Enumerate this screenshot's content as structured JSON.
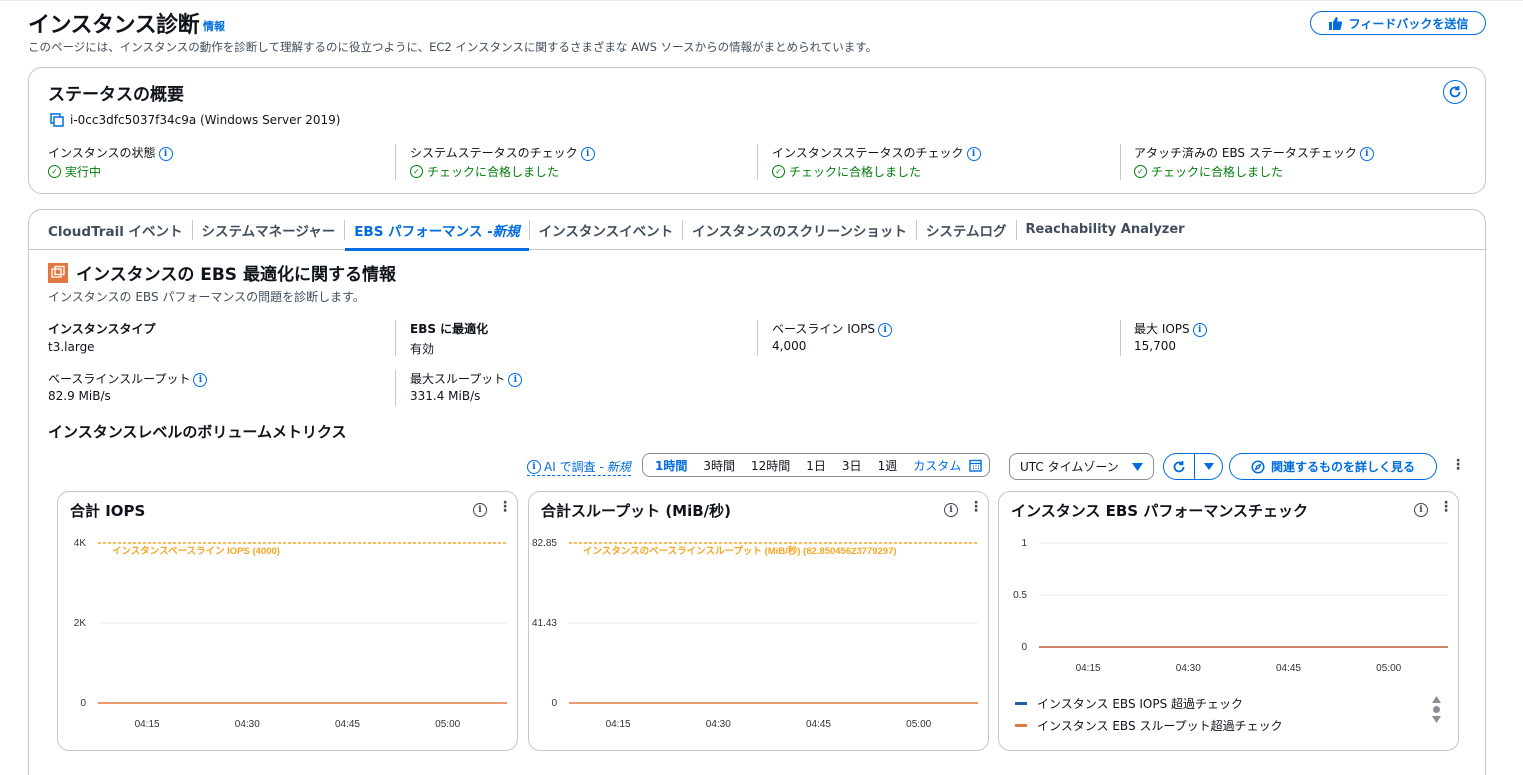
{
  "header": {
    "title": "インスタンス診断",
    "info_link": "情報",
    "description": "このページには、インスタンスの動作を診断して理解するのに役立つように、EC2 インスタンスに関するさまざまな AWS ソースからの情報がまとめられています。",
    "feedback_button": "フィードバックを送信"
  },
  "status": {
    "title": "ステータスの概要",
    "instance_id": "i-0cc3dfc5037f34c9a (Windows Server 2019)",
    "items": [
      {
        "label": "インスタンスの状態",
        "value": "実行中"
      },
      {
        "label": "システムステータスのチェック",
        "value": "チェックに合格しました"
      },
      {
        "label": "インスタンスステータスのチェック",
        "value": "チェックに合格しました"
      },
      {
        "label": "アタッチ済みの EBS ステータスチェック",
        "value": "チェックに合格しました"
      }
    ]
  },
  "tabs": [
    {
      "label": "CloudTrail イベント"
    },
    {
      "label": "システムマネージャー"
    },
    {
      "label": "EBS パフォーマンス - ",
      "suffix": "新規",
      "active": true
    },
    {
      "label": "インスタンスイベント"
    },
    {
      "label": "インスタンスのスクリーンショット"
    },
    {
      "label": "システムログ"
    },
    {
      "label": "Reachability Analyzer"
    }
  ],
  "ebs": {
    "title": "インスタンスの EBS 最適化に関する情報",
    "subtitle": "インスタンスの EBS パフォーマンスの問題を診断します。",
    "fields": {
      "instance_type": {
        "label": "インスタンスタイプ",
        "value": "t3.large"
      },
      "ebs_optimized": {
        "label": "EBS に最適化",
        "value": "有効"
      },
      "baseline_iops": {
        "label": "ベースライン IOPS",
        "value": "4,000"
      },
      "max_iops": {
        "label": "最大 IOPS",
        "value": "15,700"
      },
      "baseline_throughput": {
        "label": "ベースラインスループット",
        "value": "82.9 MiB/s"
      },
      "max_throughput": {
        "label": "最大スループット",
        "value": "331.4 MiB/s"
      }
    },
    "metrics_title": "インスタンスレベルのボリュームメトリクス"
  },
  "toolbar": {
    "ai_investigate": "AI で調査 - ",
    "ai_new": "新規",
    "ranges": [
      "1時間",
      "3時間",
      "12時間",
      "1日",
      "3日",
      "1週"
    ],
    "selected_range": "1時間",
    "custom": "カスタム",
    "timezone": "UTC タイムゾーン",
    "explore_related": "関連するものを詳しく見る"
  },
  "chart_data": [
    {
      "type": "line",
      "title": "合計 IOPS",
      "x": [
        "04:15",
        "04:30",
        "04:45",
        "05:00"
      ],
      "yticks": [
        "4K",
        "2K",
        "0"
      ],
      "ylim": [
        0,
        4000
      ],
      "annotation": "インスタンスベースライン IOPS (4000)",
      "series": [
        {
          "values": [
            0,
            0,
            0,
            0
          ]
        }
      ],
      "colors": {
        "series": "#e07941",
        "annotation": "#f5a623"
      }
    },
    {
      "type": "line",
      "title": "合計スループット (MiB/秒)",
      "x": [
        "04:15",
        "04:30",
        "04:45",
        "05:00"
      ],
      "yticks": [
        "82.85",
        "41.43",
        "0"
      ],
      "ylim": [
        0,
        82.85
      ],
      "annotation": "インスタンスのベースラインスループット (MiB/秒) (82.85045623779297)",
      "series": [
        {
          "values": [
            0,
            0,
            0,
            0
          ]
        }
      ],
      "colors": {
        "series": "#e07941",
        "annotation": "#f5a623"
      }
    },
    {
      "type": "line",
      "title": "インスタンス EBS パフォーマンスチェック",
      "x": [
        "04:15",
        "04:30",
        "04:45",
        "05:00"
      ],
      "yticks": [
        "1",
        "0.5",
        "0"
      ],
      "ylim": [
        0,
        1
      ],
      "series": [
        {
          "name": "インスタンス EBS IOPS 超過チェック",
          "values": [
            0,
            0,
            0,
            0
          ],
          "color": "#1f5fa8"
        },
        {
          "name": "インスタンス EBS スループット超過チェック",
          "values": [
            0,
            0,
            0,
            0
          ],
          "color": "#e07941"
        }
      ]
    }
  ]
}
